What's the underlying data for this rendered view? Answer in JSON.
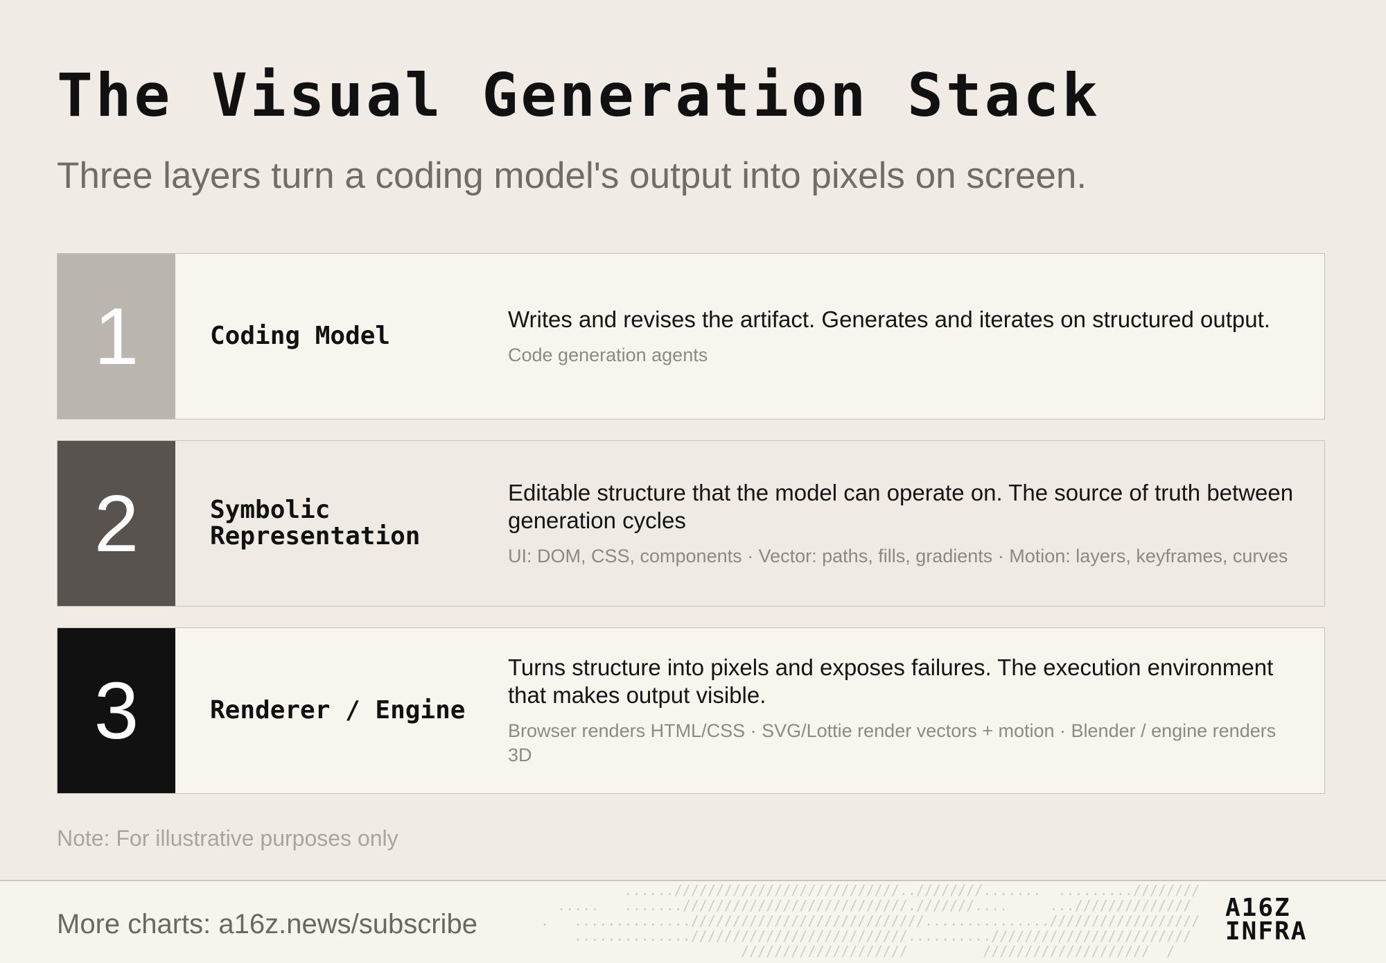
{
  "title": "The Visual Generation Stack",
  "subtitle": "Three layers turn a coding model's output into pixels on screen.",
  "layers": [
    {
      "number": "1",
      "name": "Coding Model",
      "description": "Writes and revises the artifact. Generates and iterates on structured output.",
      "examples": "Code generation agents"
    },
    {
      "number": "2",
      "name": "Symbolic Representation",
      "description": "Editable structure that the model can operate on. The source of truth between generation cycles",
      "examples": "UI: DOM, CSS, components  ·  Vector: paths, fills, gradients  ·  Motion: layers, keyframes, curves"
    },
    {
      "number": "3",
      "name": "Renderer / Engine",
      "description": "Turns structure into pixels and exposes failures. The execution environment that makes output visible.",
      "examples": "Browser renders HTML/CSS  ·  SVG/Lottie render vectors + motion  ·  Blender / engine renders 3D"
    }
  ],
  "note": "Note: For illustrative purposes only",
  "footer": {
    "text": "More charts: a16z.news/subscribe",
    "logo_line1": "A16Z",
    "logo_line2": "INFRA"
  },
  "colors": {
    "background": "#f0ece5",
    "layer1_block": "#bbb5b0",
    "layer2_block": "#58534f",
    "layer3_block": "#111111"
  }
}
